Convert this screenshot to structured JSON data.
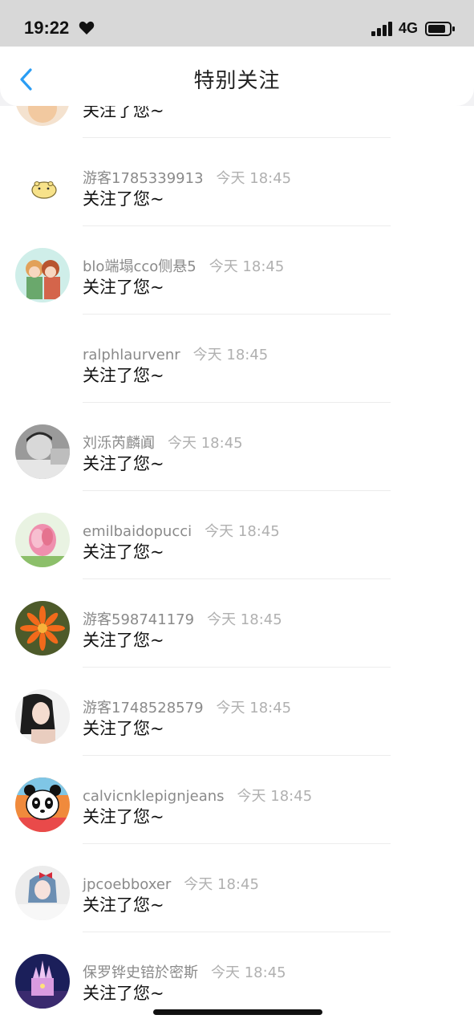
{
  "status_bar": {
    "time": "19:22",
    "network": "4G",
    "icons": [
      "heart-icon",
      "signal-icon",
      "battery-icon"
    ]
  },
  "nav": {
    "title": "特别关注",
    "back_icon": "chevron-left-icon",
    "accent": "#2a9df4"
  },
  "partial_row": {
    "message": "关注了您~"
  },
  "rows": [
    {
      "name": "游客1785339913",
      "time": "今天 18:45",
      "message": "关注了您~",
      "avatar": "hamster-sticker"
    },
    {
      "name": "blo端塌cco侧悬5",
      "time": "今天 18:45",
      "message": "关注了您~",
      "avatar": "anime-girls"
    },
    {
      "name": "ralphlaurvenr",
      "time": "今天 18:45",
      "message": "关注了您~",
      "avatar": "blank"
    },
    {
      "name": "刘泺芮麟阗",
      "time": "今天 18:45",
      "message": "关注了您~",
      "avatar": "man-photo"
    },
    {
      "name": "emilbaidopucci",
      "time": "今天 18:45",
      "message": "关注了您~",
      "avatar": "pink-flower"
    },
    {
      "name": "游客598741179",
      "time": "今天 18:45",
      "message": "关注了您~",
      "avatar": "orange-flower"
    },
    {
      "name": "游客1748528579",
      "time": "今天 18:45",
      "message": "关注了您~",
      "avatar": "woman-photo"
    },
    {
      "name": "calvicnklepignjeans",
      "time": "今天 18:45",
      "message": "关注了您~",
      "avatar": "panda-cartoon"
    },
    {
      "name": "jpcoebboxer",
      "time": "今天 18:45",
      "message": "关注了您~",
      "avatar": "girl-bow"
    },
    {
      "name": "保罗铧史锫於密斯",
      "time": "今天 18:45",
      "message": "关注了您~",
      "avatar": "castle-night"
    }
  ]
}
